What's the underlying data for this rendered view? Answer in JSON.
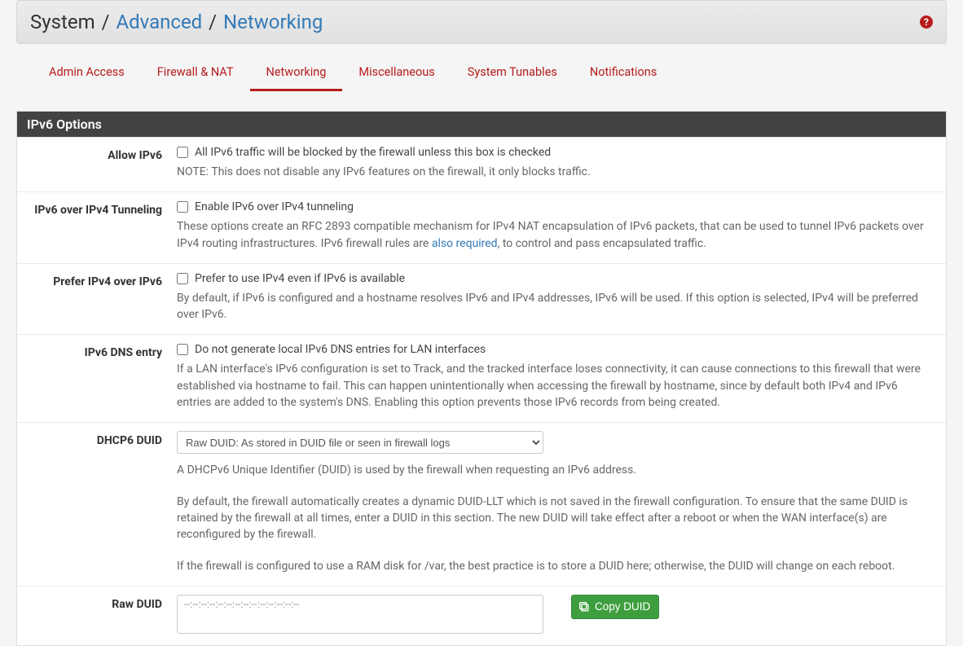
{
  "breadcrumb": {
    "root": "System",
    "mid": "Advanced",
    "leaf": "Networking"
  },
  "tabs": [
    {
      "label": "Admin Access",
      "active": false
    },
    {
      "label": "Firewall & NAT",
      "active": false
    },
    {
      "label": "Networking",
      "active": true
    },
    {
      "label": "Miscellaneous",
      "active": false
    },
    {
      "label": "System Tunables",
      "active": false
    },
    {
      "label": "Notifications",
      "active": false
    }
  ],
  "panel": {
    "title": "IPv6 Options",
    "rows": {
      "allow_ipv6": {
        "label": "Allow IPv6",
        "check_text": "All IPv6 traffic will be blocked by the firewall unless this box is checked",
        "help": "NOTE: This does not disable any IPv6 features on the firewall, it only blocks traffic."
      },
      "ipv6_over_ipv4": {
        "label": "IPv6 over IPv4 Tunneling",
        "check_text": "Enable IPv6 over IPv4 tunneling",
        "help_pre": "These options create an RFC 2893 compatible mechanism for IPv4 NAT encapsulation of IPv6 packets, that can be used to tunnel IPv6 packets over IPv4 routing infrastructures. IPv6 firewall rules are ",
        "help_link": "also required",
        "help_post": ", to control and pass encapsulated traffic."
      },
      "prefer_ipv4": {
        "label": "Prefer IPv4 over IPv6",
        "check_text": "Prefer to use IPv4 even if IPv6 is available",
        "help": "By default, if IPv6 is configured and a hostname resolves IPv6 and IPv4 addresses, IPv6 will be used. If this option is selected, IPv4 will be preferred over IPv6."
      },
      "ipv6_dns": {
        "label": "IPv6 DNS entry",
        "check_text": "Do not generate local IPv6 DNS entries for LAN interfaces",
        "help": "If a LAN interface's IPv6 configuration is set to Track, and the tracked interface loses connectivity, it can cause connections to this firewall that were established via hostname to fail. This can happen unintentionally when accessing the firewall by hostname, since by default both IPv4 and IPv6 entries are added to the system's DNS. Enabling this option prevents those IPv6 records from being created."
      },
      "dhcp6_duid": {
        "label": "DHCP6 DUID",
        "select_value": "Raw DUID: As stored in DUID file or seen in firewall logs",
        "help1": "A DHCPv6 Unique Identifier (DUID) is used by the firewall when requesting an IPv6 address.",
        "help2": "By default, the firewall automatically creates a dynamic DUID-LLT which is not saved in the firewall configuration. To ensure that the same DUID is retained by the firewall at all times, enter a DUID in this section. The new DUID will take effect after a reboot or when the WAN interface(s) are reconfigured by the firewall.",
        "help3": "If the firewall is configured to use a RAM disk for /var, the best practice is to store a DUID here; otherwise, the DUID will change on each reboot."
      },
      "raw_duid": {
        "label": "Raw DUID",
        "placeholder": "--:--:--:--:--:--:--:--:--:--:--:--:--:--",
        "copy_label": "Copy DUID"
      }
    }
  }
}
